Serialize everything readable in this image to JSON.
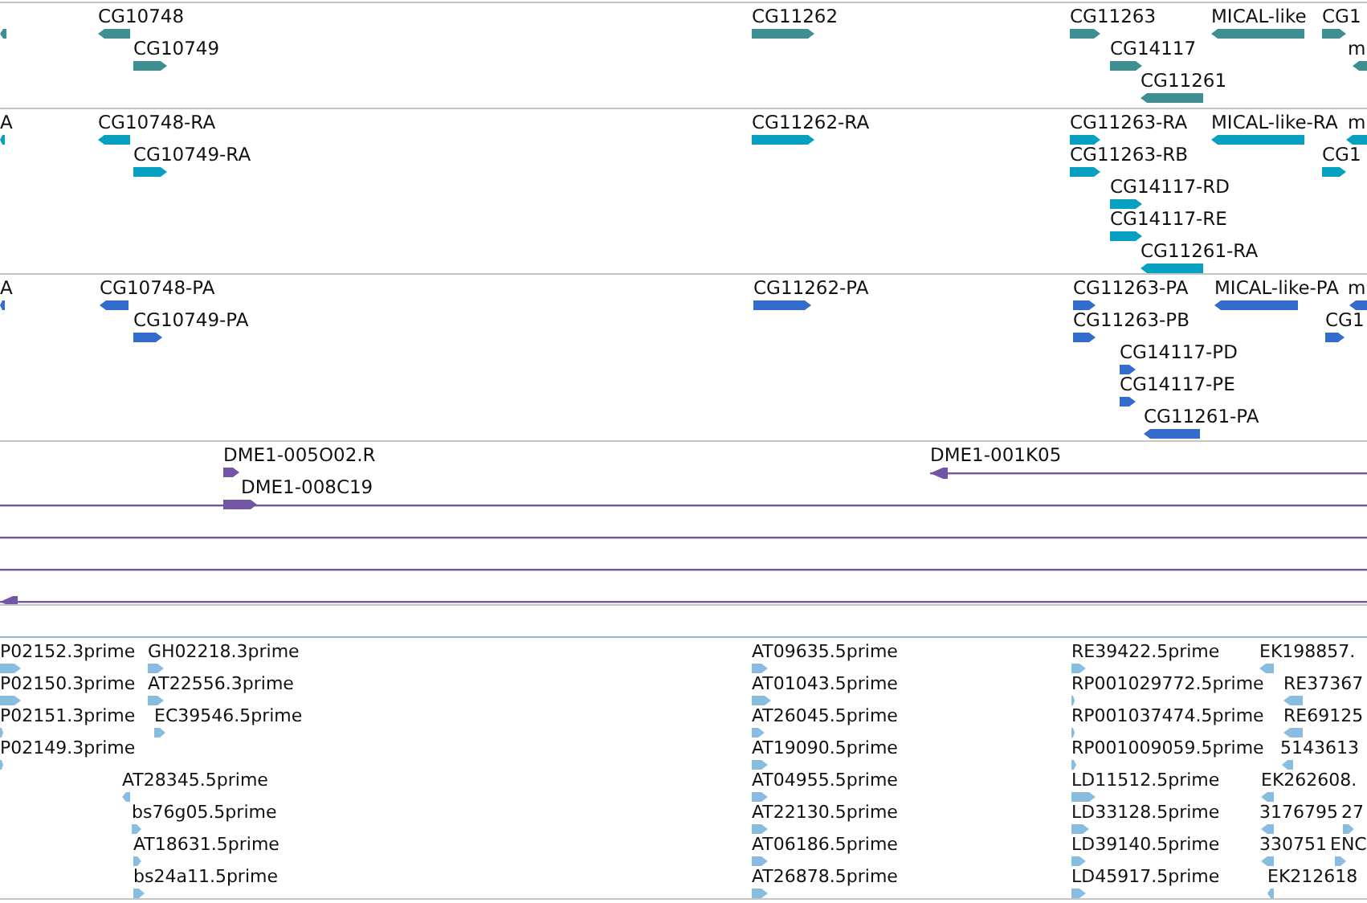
{
  "tracks": [
    {
      "kind": "gene",
      "color": "#3f8f92",
      "features": [
        {
          "reverse": true
        },
        {
          "label": "CG10748",
          "reverse": true
        },
        {
          "label": "CG10749",
          "reverse": false
        },
        {
          "label": "CG11262",
          "reverse": false
        },
        {
          "label": "CG11263",
          "reverse": false
        },
        {
          "label": "CG14117",
          "reverse": false
        },
        {
          "label": "CG11261",
          "reverse": true
        },
        {
          "label": "MICAL-like",
          "reverse": true
        },
        {
          "label": "CG1",
          "reverse": false
        },
        {
          "label": "m",
          "reverse": true
        }
      ]
    },
    {
      "kind": "transcript",
      "color": "#08a0c0",
      "features": [
        {
          "label": "A",
          "reverse": true
        },
        {
          "label": "CG10748-RA",
          "reverse": true
        },
        {
          "label": "CG10749-RA",
          "reverse": false
        },
        {
          "label": "CG11262-RA",
          "reverse": false
        },
        {
          "label": "CG11263-RA",
          "reverse": false
        },
        {
          "label": "CG11263-RB",
          "reverse": false
        },
        {
          "label": "CG14117-RD",
          "reverse": false
        },
        {
          "label": "CG14117-RE",
          "reverse": false
        },
        {
          "label": "CG11261-RA",
          "reverse": true
        },
        {
          "label": "MICAL-like-RA",
          "reverse": true
        },
        {
          "label": "m",
          "reverse": true
        },
        {
          "label": "CG1",
          "reverse": false
        }
      ]
    },
    {
      "kind": "protein",
      "color": "#336ccc",
      "features": [
        {
          "label": "A",
          "reverse": true
        },
        {
          "label": "CG10748-PA",
          "reverse": true
        },
        {
          "label": "CG10749-PA",
          "reverse": false
        },
        {
          "label": "CG11262-PA",
          "reverse": false
        },
        {
          "label": "CG11263-PA",
          "reverse": false
        },
        {
          "label": "CG11263-PB",
          "reverse": false
        },
        {
          "label": "CG14117-PD",
          "reverse": false
        },
        {
          "label": "CG14117-PE",
          "reverse": false
        },
        {
          "label": "CG11261-PA",
          "reverse": true
        },
        {
          "label": "MICAL-like-PA",
          "reverse": true
        },
        {
          "label": "m",
          "reverse": true
        },
        {
          "label": "CG1",
          "reverse": false
        }
      ]
    },
    {
      "kind": "clone",
      "color": "#7355a5",
      "features": [
        {
          "label": "DME1-005O02.R",
          "reverse": false,
          "kind": "block"
        },
        {
          "label": "DME1-008C19",
          "reverse": false,
          "kind": "block"
        },
        {
          "label": "DME1-001K05",
          "reverse": true,
          "kind": "line"
        },
        {
          "kind": "line"
        },
        {
          "kind": "line"
        },
        {
          "kind": "line"
        },
        {
          "reverse": true,
          "kind": "line"
        }
      ]
    },
    {
      "kind": "est",
      "color": "#88bde0",
      "features": [
        {
          "label": "P02152.3prime",
          "reverse": false
        },
        {
          "label": "P02150.3prime",
          "reverse": false
        },
        {
          "label": "P02151.3prime",
          "reverse": false
        },
        {
          "label": "P02149.3prime",
          "reverse": false
        },
        {
          "label": "GH02218.3prime",
          "reverse": false
        },
        {
          "label": "AT22556.3prime",
          "reverse": false
        },
        {
          "label": "EC39546.5prime",
          "reverse": false
        },
        {
          "label": "AT28345.5prime",
          "reverse": true
        },
        {
          "label": "bs76g05.5prime",
          "reverse": false
        },
        {
          "label": "AT18631.5prime",
          "reverse": false
        },
        {
          "label": "bs24a11.5prime",
          "reverse": false
        },
        {
          "label": "AT09635.5prime",
          "reverse": false
        },
        {
          "label": "AT01043.5prime",
          "reverse": false
        },
        {
          "label": "AT26045.5prime",
          "reverse": false
        },
        {
          "label": "AT19090.5prime",
          "reverse": false
        },
        {
          "label": "AT04955.5prime",
          "reverse": false
        },
        {
          "label": "AT22130.5prime",
          "reverse": false
        },
        {
          "label": "AT06186.5prime",
          "reverse": false
        },
        {
          "label": "AT26878.5prime",
          "reverse": false
        },
        {
          "label": "RE39422.5prime",
          "reverse": false
        },
        {
          "label": "RP001029772.5prime",
          "reverse": false
        },
        {
          "label": "RP001037474.5prime",
          "reverse": false
        },
        {
          "label": "RP001009059.5prime",
          "reverse": false
        },
        {
          "label": "LD11512.5prime",
          "reverse": false
        },
        {
          "label": "LD33128.5prime",
          "reverse": false
        },
        {
          "label": "LD39140.5prime",
          "reverse": false
        },
        {
          "label": "LD45917.5prime",
          "reverse": false
        },
        {
          "label": "EK198857.",
          "reverse": true
        },
        {
          "label": "RE37367",
          "reverse": true
        },
        {
          "label": "RE69125",
          "reverse": true
        },
        {
          "label": "5143613",
          "reverse": true
        },
        {
          "label": "EK262608.",
          "reverse": true
        },
        {
          "label": "3176795",
          "reverse": true
        },
        {
          "label": "27",
          "reverse": false
        },
        {
          "label": "330751",
          "reverse": true
        },
        {
          "label": "ENC",
          "reverse": false
        },
        {
          "label": "EK212618",
          "reverse": true
        }
      ]
    }
  ]
}
